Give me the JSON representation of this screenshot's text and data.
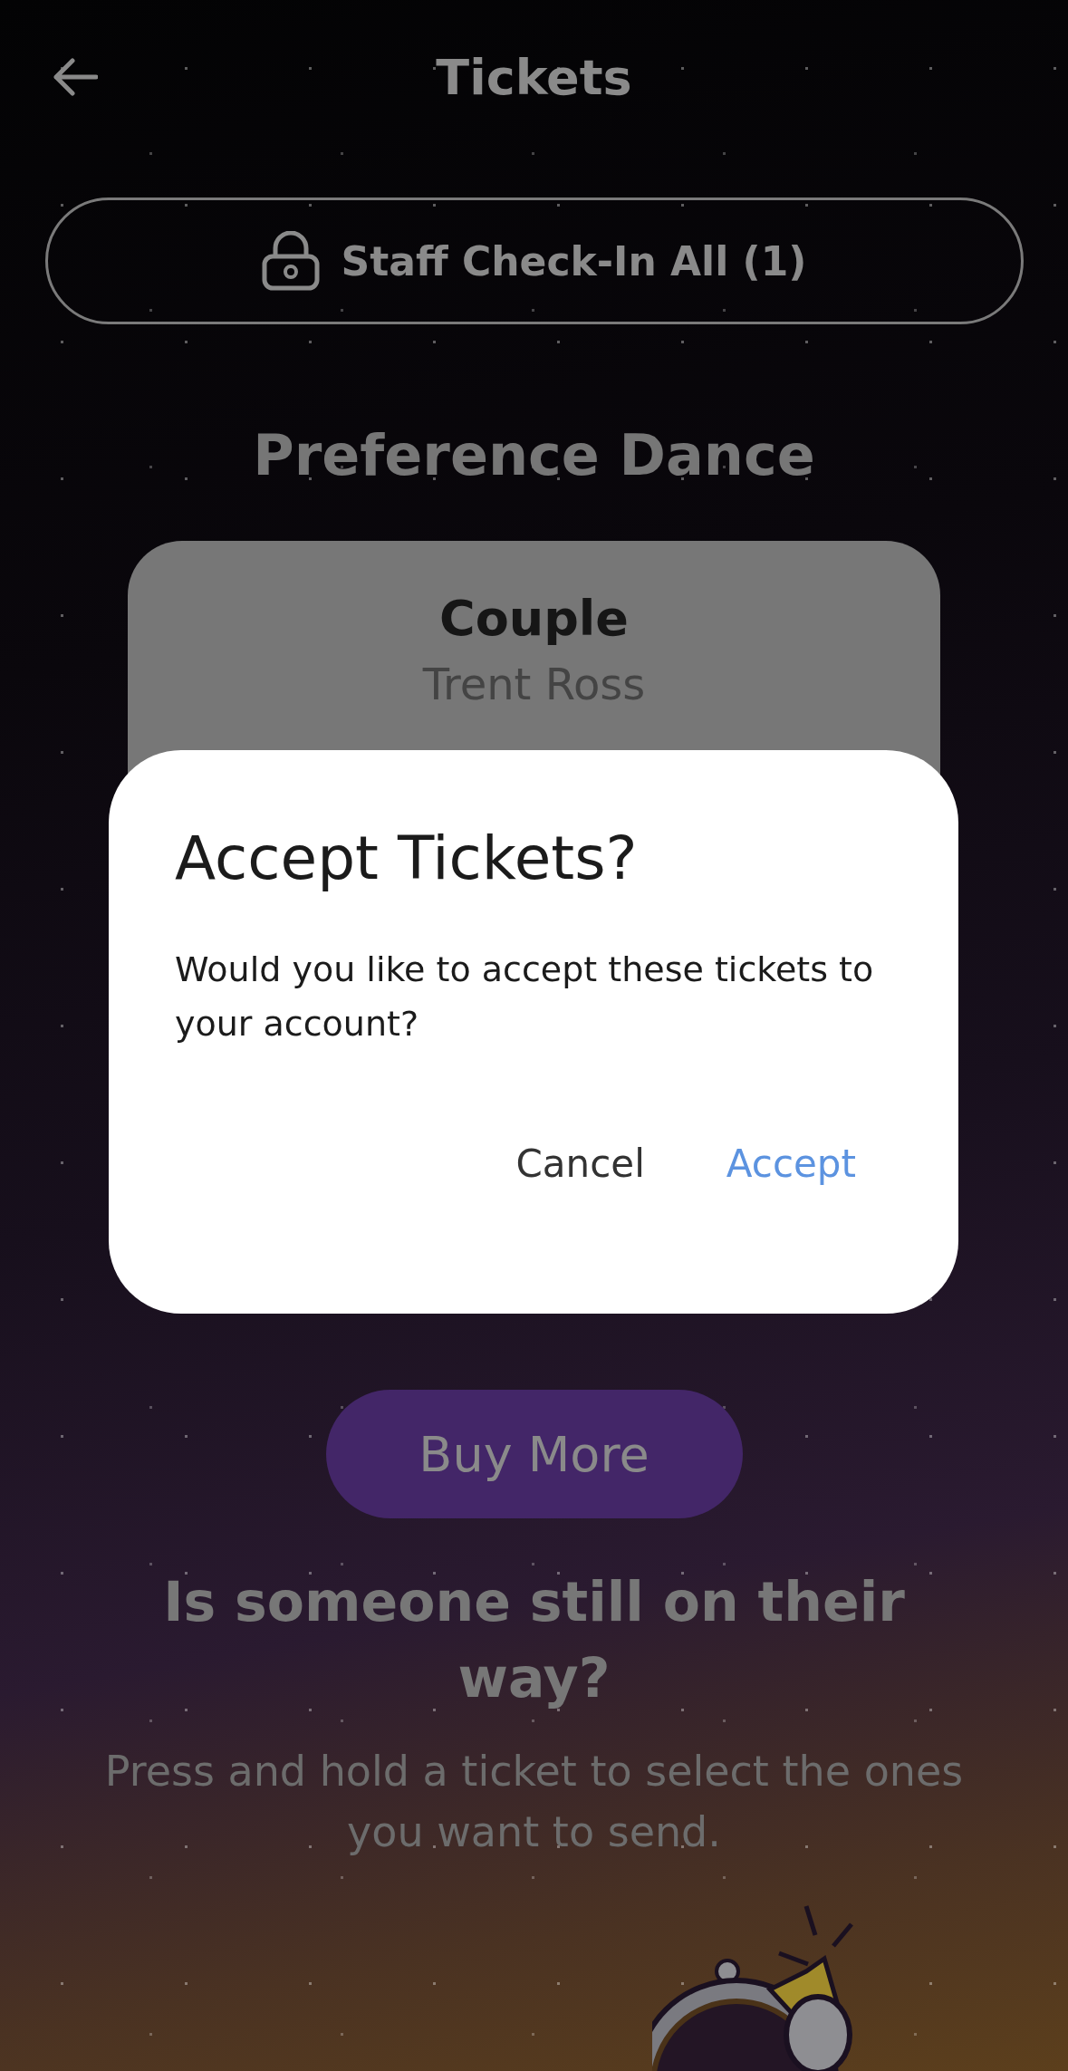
{
  "header": {
    "title": "Tickets"
  },
  "staff_button": {
    "label": "Staff Check-In All (1)"
  },
  "event_title": "Preference Dance",
  "tickets": [
    {
      "type": "Couple",
      "holder": "Trent Ross"
    }
  ],
  "buy_button": {
    "label": "Buy More"
  },
  "help": {
    "title": "Is someone still on their way?",
    "text": "Press and hold a ticket to select the ones you want to send."
  },
  "dialog": {
    "title": "Accept Tickets?",
    "message": "Would you like to accept these tickets to your account?",
    "actions": [
      {
        "label": "Cancel",
        "kind": "secondary"
      },
      {
        "label": "Accept",
        "kind": "primary"
      }
    ]
  }
}
